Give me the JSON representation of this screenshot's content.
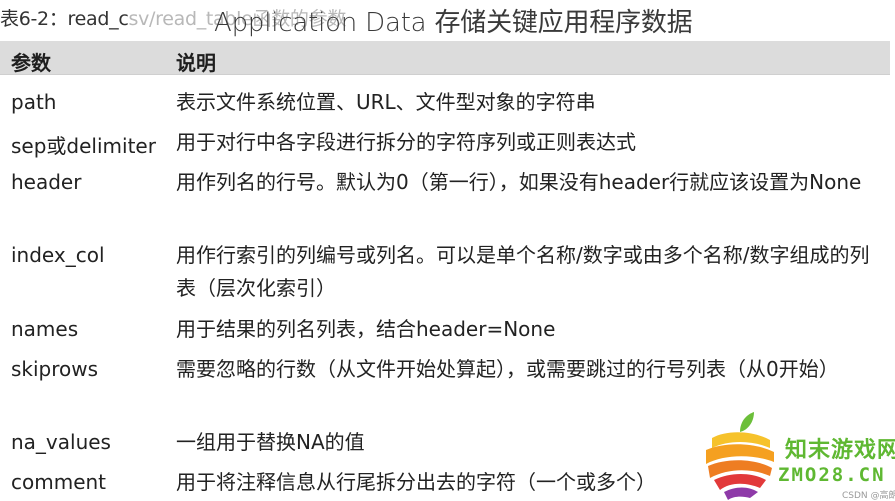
{
  "caption": {
    "prefix": "表6-2：read_c",
    "faded_suffix": "sv/read_table函数的参数"
  },
  "overlay_title": "Application Data 存储关键应用程序数据",
  "table": {
    "headers": {
      "param": "参数",
      "desc": "说明"
    },
    "rows": [
      {
        "param": "path",
        "desc": "表示文件系统位置、URL、文件型对象的字符串"
      },
      {
        "param": "sep或delimiter",
        "desc": "用于对行中各字段进行拆分的字符序列或正则表达式"
      },
      {
        "param": "header",
        "desc": "用作列名的行号。默认为0（第一行），如果没有header行就应该设置为None"
      },
      {
        "param": "index_col",
        "desc": "用作行索引的列编号或列名。可以是单个名称/数字或由多个名称/数字组成的列表（层次化索引）"
      },
      {
        "param": "names",
        "desc": "用于结果的列名列表，结合header=None"
      },
      {
        "param": "skiprows",
        "desc": "需要忽略的行数（从文件开始处算起），或需要跳过的行号列表（从0开始）"
      },
      {
        "param": "na_values",
        "desc": "一组用于替换NA的值"
      },
      {
        "param": "comment",
        "desc": "用于将注释信息从行尾拆分出去的字符（一个或多个）"
      }
    ]
  },
  "watermark": {
    "site_name": "知末游戏网",
    "domain": "ZMO28.CN",
    "credit": "CSDN @高朗"
  },
  "colors": {
    "header_band": "#dcdcdc",
    "watermark_green": "#5fb832"
  }
}
